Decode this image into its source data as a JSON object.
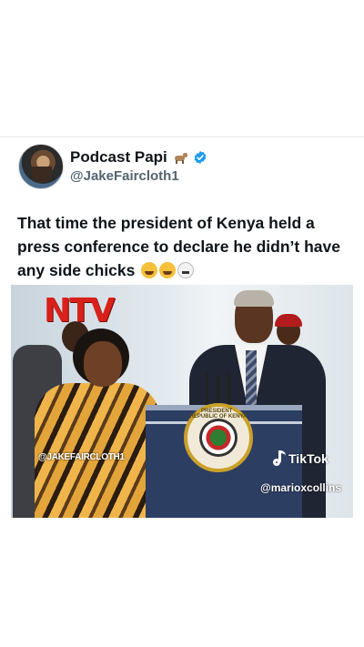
{
  "tweet": {
    "display_name": "Podcast Papi",
    "name_emoji_icon": "goat-icon",
    "verified_icon": "verified-badge-icon",
    "handle": "@JakeFaircloth1",
    "text": "That time the president of Kenya held a press conference to declare he didn’t have any side chicks",
    "trailing_emojis": [
      "weary-face-emoji",
      "tears-of-joy-emoji",
      "skull-emoji"
    ]
  },
  "media": {
    "broadcaster_logo": "NTV",
    "uploader_watermark": "@JAKEFAIRCLOTH1",
    "platform_logo": "TikTok",
    "creator_watermark": "@marioxcollins",
    "seal_text": "PRESIDENT · REPUBLIC OF KENYA"
  },
  "colors": {
    "accent_verified": "#1d9bf0",
    "text_primary": "#0f1419",
    "text_secondary": "#536471",
    "ntv_red": "#d9201a"
  }
}
